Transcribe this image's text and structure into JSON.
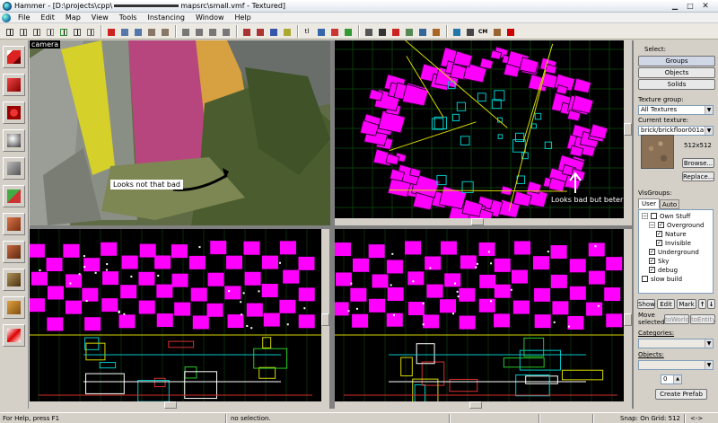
{
  "window": {
    "title": "Hammer - [D:\\projects\\cpp\\",
    "title_suffix": "mapsrc\\small.vmf - Textured]",
    "controls": [
      "minimize-icon",
      "maximize-icon",
      "close-icon"
    ]
  },
  "menu": [
    "File",
    "Edit",
    "Map",
    "View",
    "Tools",
    "Instancing",
    "Window",
    "Help"
  ],
  "toolbar_icons": [
    "grid-icon",
    "grid-smaller-icon",
    "grid-larger-icon",
    "grid3d-icon",
    "grid-dots-icon",
    "grid-lines-icon",
    "grid-snap-icon",
    "carve-icon",
    "group-icon",
    "ungroup-icon",
    "hide-icon",
    "unhide-icon",
    "cut-icon",
    "copy-icon",
    "paste-icon",
    "paste-special-icon",
    "hollow-icon",
    "tie-icon",
    "move-to-world-icon",
    "cordon-icon",
    "tools-text-icon",
    "entity-list-icon",
    "check-icon",
    "run-map-icon",
    "zoom-icon",
    "box-icon",
    "flag-icon",
    "align-icon",
    "transform-icon",
    "texture-lock-icon",
    "uv-lock-icon",
    "vm-icon",
    "cm-icon",
    "tile-icon",
    "run-icon"
  ],
  "toolbar_labels": {
    "tl": "tl",
    "cm": "CM"
  },
  "left_tools": [
    "selection-tool-icon",
    "magnify-tool-icon",
    "camera-tool-icon",
    "entity-tool-icon",
    "block-tool-icon",
    "texture-application-icon",
    "apply-current-texture-icon",
    "decal-tool-icon",
    "overlay-tool-icon",
    "clipping-tool-icon",
    "vertex-tool-icon"
  ],
  "views": {
    "camera_label": "camera",
    "annotation_left": "Looks not that bad",
    "annotation_right": "Looks bad but beter"
  },
  "panel": {
    "select_label": "Select:",
    "groups": "Groups",
    "objects": "Objects",
    "solids": "Solids",
    "texture_group_label": "Texture group:",
    "texture_group_value": "All Textures",
    "current_texture_label": "Current texture:",
    "current_texture_value": "brick/brickfloor001a",
    "texture_size": "512x512",
    "browse": "Browse...",
    "replace": "Replace...",
    "visgroups_label": "VisGroups:",
    "tab_user": "User",
    "tab_auto": "Auto",
    "visgroups": [
      {
        "label": "Own Stuff",
        "checked": false,
        "expander": "−",
        "depth": 0
      },
      {
        "label": "Overground",
        "checked": true,
        "expander": "−",
        "depth": 1
      },
      {
        "label": "Nature",
        "checked": true,
        "expander": "",
        "depth": 2
      },
      {
        "label": "Invisible",
        "checked": true,
        "expander": "",
        "depth": 2
      },
      {
        "label": "Underground",
        "checked": true,
        "expander": "",
        "depth": 1
      },
      {
        "label": "Sky",
        "checked": true,
        "expander": "",
        "depth": 1
      },
      {
        "label": "debug",
        "checked": true,
        "expander": "",
        "depth": 1
      },
      {
        "label": "slow build",
        "checked": false,
        "expander": "",
        "depth": 0
      }
    ],
    "show": "Show",
    "edit": "Edit",
    "mark": "Mark",
    "up": "↑",
    "down": "↓",
    "move_selected_label": "Move selected:",
    "to_world": "toWorld",
    "to_entity": "toEntity",
    "categories_label": "Categories:",
    "objects_label": "Objects:",
    "count_value": "0",
    "create_prefab": "Create Prefab"
  },
  "status": {
    "help": "For Help, press F1",
    "selection": "no selection.",
    "snap": "Snap: On Grid: 512",
    "extra": "<->"
  },
  "colors": {
    "magenta": "#ff00ff",
    "wire_cyan": "#00c8c8",
    "wire_yellow": "#d8d800",
    "wire_green": "#28c828"
  }
}
